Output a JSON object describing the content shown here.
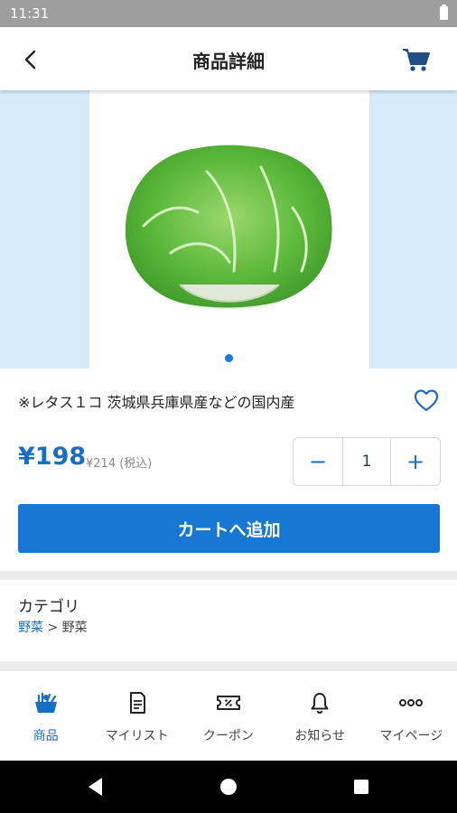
{
  "status_bar": {
    "time": "11:31"
  },
  "app_bar": {
    "title": "商品詳細",
    "back_icon": "chevron-left-icon",
    "cart_icon": "cart-icon"
  },
  "product": {
    "image_description_icon": "lettuce-photo",
    "name": "※レタス１コ 茨城県兵庫県産などの国内産",
    "price": "¥198",
    "price_with_tax": "¥214 (税込)",
    "quantity": "1",
    "minus_label": "−",
    "plus_label": "+",
    "add_to_cart_label": "カートへ追加",
    "favorite_icon": "heart-outline-icon",
    "gallery_page": 1,
    "gallery_total": 1
  },
  "category": {
    "heading": "カテゴリ",
    "path_link": "野菜",
    "separator": " > ",
    "path_current": "野菜"
  },
  "tabs": [
    {
      "label": "商品",
      "icon": "groceries-icon",
      "active": true
    },
    {
      "label": "マイリスト",
      "icon": "list-icon",
      "active": false
    },
    {
      "label": "クーポン",
      "icon": "coupon-icon",
      "active": false
    },
    {
      "label": "お知らせ",
      "icon": "bell-icon",
      "active": false
    },
    {
      "label": "マイページ",
      "icon": "more-dots-icon",
      "active": false
    }
  ],
  "colors": {
    "accent": "#1777d2",
    "gallery_bg": "#d6ebfa",
    "status_bar": "#9e9e9e"
  }
}
